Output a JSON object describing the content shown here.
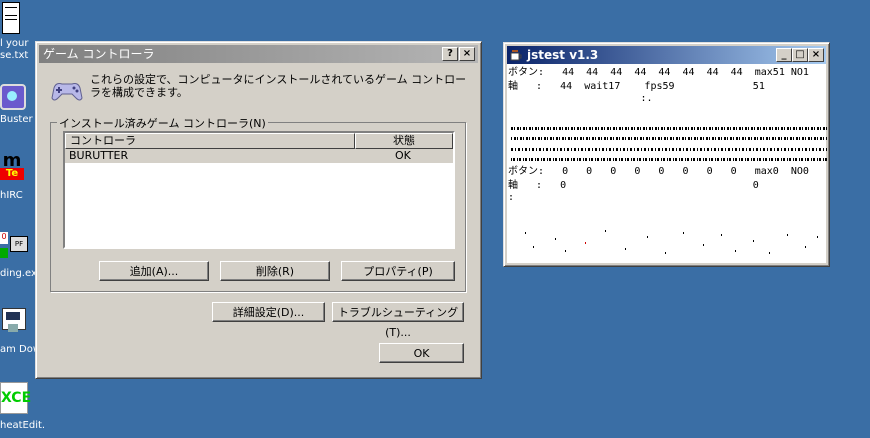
{
  "desktop": {
    "icons": [
      {
        "label": "l your\nse.txt",
        "icon": "text-file-icon"
      },
      {
        "label": "Buster",
        "icon": "app-icon"
      },
      {
        "label": "hIRC",
        "icon": "mirc-icon"
      },
      {
        "label": "ding.exe",
        "icon": "app-icon"
      },
      {
        "label": "am Dow",
        "icon": "download-icon"
      },
      {
        "label": "heatEdit...",
        "icon": "cheat-edit-icon"
      }
    ],
    "background_color": "#3a6ea5"
  },
  "game_controller_dialog": {
    "title": "ゲーム コントローラ",
    "help_button": "?",
    "close_button": "×",
    "description": "これらの設定で、コンピュータにインストールされているゲーム コントローラを構成できます。",
    "group_label": "インストール済みゲーム コントローラ(N)",
    "columns": [
      "コントローラ",
      "状態"
    ],
    "rows": [
      {
        "controller": "BURUTTER",
        "status": "OK"
      }
    ],
    "buttons": {
      "add": "追加(A)...",
      "remove": "削除(R)",
      "properties": "プロパティ(P)",
      "advanced": "詳細設定(D)...",
      "troubleshoot": "トラブルシューティング(T)...",
      "ok": "OK"
    }
  },
  "jstest_window": {
    "title": "jstest v1.3",
    "minimize": "_",
    "maximize": "□",
    "close": "×",
    "lines": [
      "ボタン:   44  44  44  44  44  44  44  44  max51 NO1",
      "軸   :   44  wait17    fps59             51",
      "                      :.",
      "ボタン:   0   0   0   0   0   0   0   0   max0  NO0",
      "軸   :   0                               0",
      ":"
    ]
  }
}
